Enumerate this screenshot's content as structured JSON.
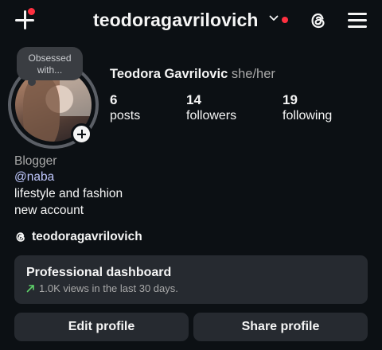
{
  "header": {
    "username": "teodoragavrilovich"
  },
  "profile": {
    "note": "Obsessed with...",
    "full_name": "Teodora Gavrilovic",
    "pronouns": "she/her",
    "stats": [
      {
        "value": "6",
        "label": "posts"
      },
      {
        "value": "14",
        "label": "followers"
      },
      {
        "value": "19",
        "label": "following"
      }
    ],
    "category": "Blogger",
    "mention": "@naba",
    "bio_lines": [
      "lifestyle and fashion",
      "new account"
    ],
    "threads_handle": "teodoragavrilovich"
  },
  "dashboard": {
    "title": "Professional dashboard",
    "subtitle": "1.0K views in the last 30 days."
  },
  "actions": {
    "edit_label": "Edit profile",
    "share_label": "Share profile"
  },
  "colors": {
    "background": "#0c1014",
    "notification": "#ff3040",
    "mention": "#c1c9ff",
    "card": "#262a30",
    "trend": "#5fd46a"
  },
  "icons": {
    "create": "plus-icon",
    "account_switch": "chevron-down-icon",
    "threads": "threads-icon",
    "menu": "hamburger-menu-icon",
    "add_story": "add-story-icon",
    "trend": "trend-up-arrow-icon"
  }
}
